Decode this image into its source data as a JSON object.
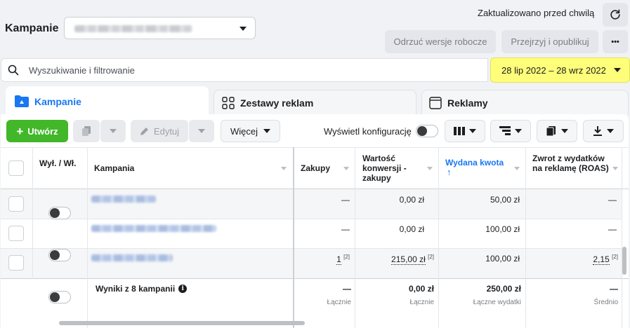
{
  "header": {
    "title": "Kampanie",
    "updated_text": "Zaktualizowano przed chwilą",
    "discard_label": "Odrzuć wersje robocze",
    "review_label": "Przejrzyj i opublikuj",
    "more_label": "•••"
  },
  "search": {
    "placeholder": "Wyszukiwanie i filtrowanie"
  },
  "date_range": "28 lip 2022 – 28 wrz 2022",
  "tabs": [
    {
      "label": "Kampanie"
    },
    {
      "label": "Zestawy reklam"
    },
    {
      "label": "Reklamy"
    }
  ],
  "toolbar": {
    "create_label": "Utwórz",
    "edit_label": "Edytuj",
    "more_label": "Więcej",
    "show_config_label": "Wyświetl konfigurację"
  },
  "table": {
    "headers": {
      "toggle": "Wył. / Wł.",
      "campaign": "Kampania",
      "purchases": "Zakupy",
      "conv_value": "Wartość konwersji - zakupy",
      "spent": "Wydana kwota",
      "spent_arrow": "↑",
      "roas": "Zwrot z wydatków na reklamę (ROAS)"
    },
    "rows": [
      {
        "purchases": "—",
        "conv_value": "0,00 zł",
        "spent": "50,00 zł",
        "roas": "—"
      },
      {
        "purchases": "—",
        "conv_value": "0,00 zł",
        "spent": "100,00 zł",
        "roas": "—"
      },
      {
        "purchases": "1",
        "purchases_sup": "[2]",
        "conv_value": "215,00 zł",
        "conv_value_sup": "[2]",
        "spent": "100,00 zł",
        "roas": "2,15",
        "roas_sup": "[2]"
      }
    ],
    "summary": {
      "label": "Wyniki z 8 kampanii",
      "purchases": "—",
      "purchases_sub": "Łącznie",
      "conv_value": "0,00 zł",
      "conv_value_sub": "Łącznie",
      "spent": "250,00 zł",
      "spent_sub": "Łączne wydatki",
      "roas": "—",
      "roas_sub": "Średnio"
    }
  },
  "colors": {
    "accent_blue": "#1877f2",
    "create_green": "#42b72a",
    "date_highlight": "#fffe7a"
  }
}
